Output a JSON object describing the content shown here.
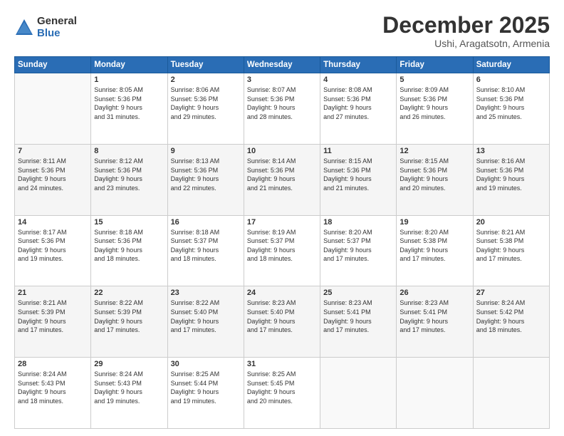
{
  "logo": {
    "general": "General",
    "blue": "Blue"
  },
  "header": {
    "month": "December 2025",
    "location": "Ushi, Aragatsotn, Armenia"
  },
  "weekdays": [
    "Sunday",
    "Monday",
    "Tuesday",
    "Wednesday",
    "Thursday",
    "Friday",
    "Saturday"
  ],
  "weeks": [
    [
      {
        "day": "",
        "info": ""
      },
      {
        "day": "1",
        "info": "Sunrise: 8:05 AM\nSunset: 5:36 PM\nDaylight: 9 hours\nand 31 minutes."
      },
      {
        "day": "2",
        "info": "Sunrise: 8:06 AM\nSunset: 5:36 PM\nDaylight: 9 hours\nand 29 minutes."
      },
      {
        "day": "3",
        "info": "Sunrise: 8:07 AM\nSunset: 5:36 PM\nDaylight: 9 hours\nand 28 minutes."
      },
      {
        "day": "4",
        "info": "Sunrise: 8:08 AM\nSunset: 5:36 PM\nDaylight: 9 hours\nand 27 minutes."
      },
      {
        "day": "5",
        "info": "Sunrise: 8:09 AM\nSunset: 5:36 PM\nDaylight: 9 hours\nand 26 minutes."
      },
      {
        "day": "6",
        "info": "Sunrise: 8:10 AM\nSunset: 5:36 PM\nDaylight: 9 hours\nand 25 minutes."
      }
    ],
    [
      {
        "day": "7",
        "info": "Sunrise: 8:11 AM\nSunset: 5:36 PM\nDaylight: 9 hours\nand 24 minutes."
      },
      {
        "day": "8",
        "info": "Sunrise: 8:12 AM\nSunset: 5:36 PM\nDaylight: 9 hours\nand 23 minutes."
      },
      {
        "day": "9",
        "info": "Sunrise: 8:13 AM\nSunset: 5:36 PM\nDaylight: 9 hours\nand 22 minutes."
      },
      {
        "day": "10",
        "info": "Sunrise: 8:14 AM\nSunset: 5:36 PM\nDaylight: 9 hours\nand 21 minutes."
      },
      {
        "day": "11",
        "info": "Sunrise: 8:15 AM\nSunset: 5:36 PM\nDaylight: 9 hours\nand 21 minutes."
      },
      {
        "day": "12",
        "info": "Sunrise: 8:15 AM\nSunset: 5:36 PM\nDaylight: 9 hours\nand 20 minutes."
      },
      {
        "day": "13",
        "info": "Sunrise: 8:16 AM\nSunset: 5:36 PM\nDaylight: 9 hours\nand 19 minutes."
      }
    ],
    [
      {
        "day": "14",
        "info": "Sunrise: 8:17 AM\nSunset: 5:36 PM\nDaylight: 9 hours\nand 19 minutes."
      },
      {
        "day": "15",
        "info": "Sunrise: 8:18 AM\nSunset: 5:36 PM\nDaylight: 9 hours\nand 18 minutes."
      },
      {
        "day": "16",
        "info": "Sunrise: 8:18 AM\nSunset: 5:37 PM\nDaylight: 9 hours\nand 18 minutes."
      },
      {
        "day": "17",
        "info": "Sunrise: 8:19 AM\nSunset: 5:37 PM\nDaylight: 9 hours\nand 18 minutes."
      },
      {
        "day": "18",
        "info": "Sunrise: 8:20 AM\nSunset: 5:37 PM\nDaylight: 9 hours\nand 17 minutes."
      },
      {
        "day": "19",
        "info": "Sunrise: 8:20 AM\nSunset: 5:38 PM\nDaylight: 9 hours\nand 17 minutes."
      },
      {
        "day": "20",
        "info": "Sunrise: 8:21 AM\nSunset: 5:38 PM\nDaylight: 9 hours\nand 17 minutes."
      }
    ],
    [
      {
        "day": "21",
        "info": "Sunrise: 8:21 AM\nSunset: 5:39 PM\nDaylight: 9 hours\nand 17 minutes."
      },
      {
        "day": "22",
        "info": "Sunrise: 8:22 AM\nSunset: 5:39 PM\nDaylight: 9 hours\nand 17 minutes."
      },
      {
        "day": "23",
        "info": "Sunrise: 8:22 AM\nSunset: 5:40 PM\nDaylight: 9 hours\nand 17 minutes."
      },
      {
        "day": "24",
        "info": "Sunrise: 8:23 AM\nSunset: 5:40 PM\nDaylight: 9 hours\nand 17 minutes."
      },
      {
        "day": "25",
        "info": "Sunrise: 8:23 AM\nSunset: 5:41 PM\nDaylight: 9 hours\nand 17 minutes."
      },
      {
        "day": "26",
        "info": "Sunrise: 8:23 AM\nSunset: 5:41 PM\nDaylight: 9 hours\nand 17 minutes."
      },
      {
        "day": "27",
        "info": "Sunrise: 8:24 AM\nSunset: 5:42 PM\nDaylight: 9 hours\nand 18 minutes."
      }
    ],
    [
      {
        "day": "28",
        "info": "Sunrise: 8:24 AM\nSunset: 5:43 PM\nDaylight: 9 hours\nand 18 minutes."
      },
      {
        "day": "29",
        "info": "Sunrise: 8:24 AM\nSunset: 5:43 PM\nDaylight: 9 hours\nand 19 minutes."
      },
      {
        "day": "30",
        "info": "Sunrise: 8:25 AM\nSunset: 5:44 PM\nDaylight: 9 hours\nand 19 minutes."
      },
      {
        "day": "31",
        "info": "Sunrise: 8:25 AM\nSunset: 5:45 PM\nDaylight: 9 hours\nand 20 minutes."
      },
      {
        "day": "",
        "info": ""
      },
      {
        "day": "",
        "info": ""
      },
      {
        "day": "",
        "info": ""
      }
    ]
  ]
}
